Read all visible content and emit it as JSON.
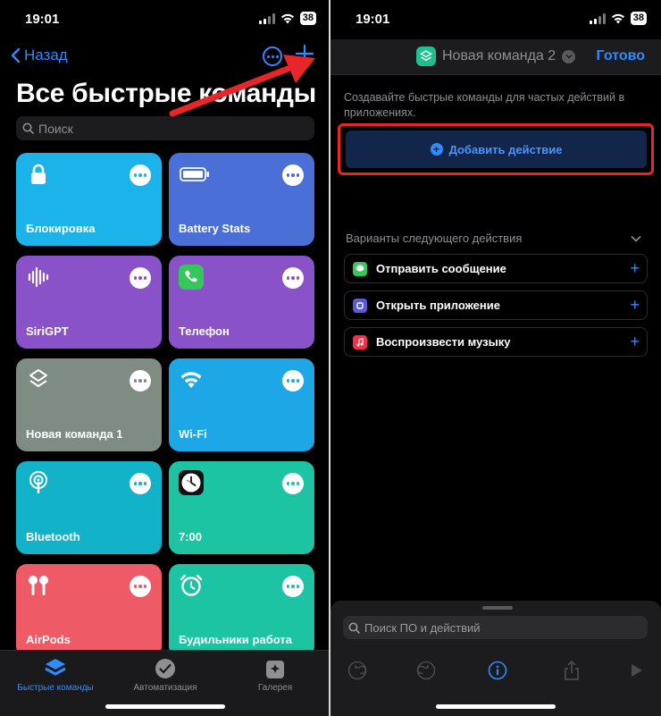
{
  "status": {
    "time": "19:01",
    "battery": "38"
  },
  "left": {
    "back_label": "Назад",
    "title": "Все быстрые команды",
    "search_placeholder": "Поиск",
    "tiles": [
      {
        "label": "Блокировка",
        "color": "#1cb3ea",
        "icon": "lock-icon"
      },
      {
        "label": "Battery Stats",
        "color": "#4a6fd6",
        "icon": "battery-icon"
      },
      {
        "label": "SiriGPT",
        "color": "#8a52c9",
        "icon": "waveform-icon"
      },
      {
        "label": "Телефон",
        "color": "#8a52c9",
        "icon": "phone-icon"
      },
      {
        "label": "Новая команда 1",
        "color": "#7e8c84",
        "icon": "layers-icon"
      },
      {
        "label": "Wi-Fi",
        "color": "#1ea7e6",
        "icon": "wifi-icon"
      },
      {
        "label": "Bluetooth",
        "color": "#12b3c8",
        "icon": "bluetooth-icon"
      },
      {
        "label": "7:00",
        "color": "#1cc4a4",
        "icon": "clock-icon"
      },
      {
        "label": "AirPods",
        "color": "#ee5b66",
        "icon": "airpods-icon"
      },
      {
        "label": "Будильники работа",
        "color": "#1cc4a4",
        "icon": "alarm-icon"
      }
    ],
    "tabs": [
      {
        "label": "Быстрые команды",
        "active": true
      },
      {
        "label": "Автоматизация",
        "active": false
      },
      {
        "label": "Галерея",
        "active": false
      }
    ]
  },
  "right": {
    "shortcut_title": "Новая команда 2",
    "done_label": "Готово",
    "hint": "Создавайте быстрые команды для частых действий в приложениях.",
    "add_action_label": "Добавить действие",
    "next_actions_header": "Варианты следующего действия",
    "next_actions": [
      {
        "label": "Отправить сообщение",
        "color": "#34c759",
        "icon": "message-icon"
      },
      {
        "label": "Открыть приложение",
        "color": "#5a5ad6",
        "icon": "app-icon"
      },
      {
        "label": "Воспроизвести музыку",
        "color": "#fa2d48",
        "icon": "music-icon"
      }
    ],
    "search_placeholder": "Поиск ПО и действий"
  },
  "colors": {
    "accent": "#2f8cff",
    "highlight_frame": "#e8262a",
    "arrow": "#e8262a"
  }
}
